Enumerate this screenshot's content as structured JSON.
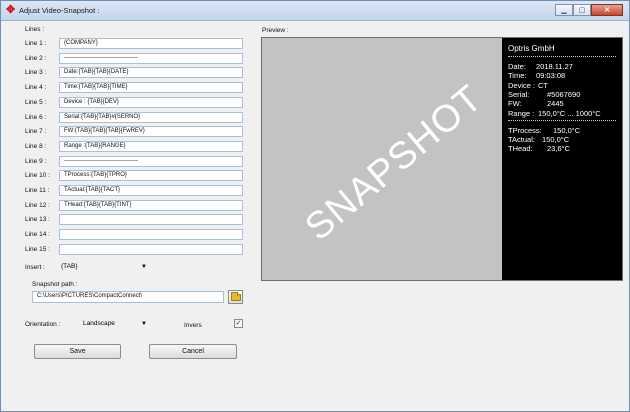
{
  "window": {
    "title": "Adjust Video-Snapshot :"
  },
  "lines_group": {
    "heading": "Lines :",
    "items": [
      {
        "label": "Line 1 :",
        "value": "{COMPANY}"
      },
      {
        "label": "Line 2 :",
        "value": "-------------------------------------"
      },
      {
        "label": "Line 3 :",
        "value": "Date:{TAB}{TAB}{DATE}"
      },
      {
        "label": "Line 4 :",
        "value": "Time:{TAB}{TAB}{TIME}"
      },
      {
        "label": "Line 5 :",
        "value": "Device : {TAB}{DEV}"
      },
      {
        "label": "Line 6 :",
        "value": "Serial:{TAB}{TAB}#{SERNO}"
      },
      {
        "label": "Line 7 :",
        "value": "FW:{TAB}{TAB}{TAB}{FwREV}"
      },
      {
        "label": "Line 8 :",
        "value": "Range :{TAB}{RANGE}"
      },
      {
        "label": "Line 9 :",
        "value": "-------------------------------------"
      },
      {
        "label": "Line 10 :",
        "value": "TProcess:{TAB}{TPRO}"
      },
      {
        "label": "Line 11 :",
        "value": "TActual:{TAB}{TACT}"
      },
      {
        "label": "Line 12 :",
        "value": "THead:{TAB}{TAB}{TINT}"
      },
      {
        "label": "Line 13 :",
        "value": ""
      },
      {
        "label": "Line 14 :",
        "value": ""
      },
      {
        "label": "Line 15 :",
        "value": ""
      }
    ]
  },
  "insert": {
    "label": "Insert :",
    "value": "{TAB}"
  },
  "snapshot_path": {
    "label": "Snapshot path :",
    "value": "C:\\Users\\PICTURES\\CompactConnect\\"
  },
  "orientation": {
    "label": "Orientation :",
    "value": "Landscape"
  },
  "invers": {
    "label": "Invers",
    "checked": true,
    "check_glyph": "✓"
  },
  "buttons": {
    "save": "Save",
    "cancel": "Cancel"
  },
  "preview": {
    "heading": "Preview :",
    "watermark": "SNAPSHOT",
    "overlay": {
      "company": "Optris GmbH",
      "rows_a": [
        {
          "k": "Date:",
          "v": "2018.11.27"
        },
        {
          "k": "Time:",
          "v": "09:03:08"
        },
        {
          "k": "Device :",
          "v": "CT"
        },
        {
          "k": "Serial:",
          "v": "#5067690"
        },
        {
          "k": "FW:",
          "v": "2445"
        },
        {
          "k": "Range :",
          "v": "150,0°C ... 1000°C"
        }
      ],
      "rows_b": [
        {
          "k": "TProcess:",
          "v": "150,0°C"
        },
        {
          "k": "TActual:",
          "v": "150,0°C"
        },
        {
          "k": "THead:",
          "v": "23,6°C"
        }
      ]
    }
  },
  "colors": {
    "accent": "#d21414",
    "field_border": "#a9bfd6",
    "preview_gray": "#c3c3c3"
  }
}
